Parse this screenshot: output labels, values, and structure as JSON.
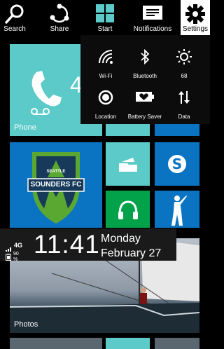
{
  "charm_bar": {
    "search": {
      "label": "Search",
      "icon": "search-icon"
    },
    "share": {
      "label": "Share",
      "icon": "share-icon"
    },
    "start": {
      "label": "Start",
      "icon": "windows-icon"
    },
    "notifications": {
      "label": "Notifications",
      "icon": "notifications-icon"
    },
    "settings": {
      "label": "Settings",
      "icon": "gear-icon"
    }
  },
  "quick_settings": [
    {
      "id": "wifi",
      "label": "Wi-Fi",
      "icon": "wifi-icon"
    },
    {
      "id": "bluetooth",
      "label": "Bluetooth",
      "icon": "bluetooth-icon"
    },
    {
      "id": "brightness",
      "label": "68",
      "icon": "brightness-icon"
    },
    {
      "id": "location",
      "label": "Location",
      "icon": "location-icon"
    },
    {
      "id": "battery_saver",
      "label": "Battery Saver",
      "icon": "battery-saver-icon"
    },
    {
      "id": "data",
      "label": "Data",
      "icon": "data-arrows-icon"
    }
  ],
  "tiles": {
    "phone": {
      "label": "Phone",
      "count": "4",
      "icon": "phone-icon"
    },
    "sounders": {
      "icon": "seattle-sounders-fc-logo",
      "logo_text_top": "SEATTLE",
      "logo_text_main": "SOUNDERS FC"
    },
    "folder": {
      "icon": "folder-icon"
    },
    "skype": {
      "icon": "skype-icon"
    },
    "music": {
      "icon": "headphones-icon"
    },
    "golf": {
      "icon": "golfer-icon"
    },
    "photos": {
      "label": "Photos"
    }
  },
  "lock_banner": {
    "signal": "4G",
    "battery": "90 %",
    "time": "11:41",
    "day": "Monday",
    "date": "February 27"
  },
  "colors": {
    "tile_teal": "#5bcac9",
    "tile_blue": "#0a74c2",
    "tile_green": "#02a24a",
    "soccer_green": "#5aa832",
    "soccer_navy": "#173a5a"
  }
}
